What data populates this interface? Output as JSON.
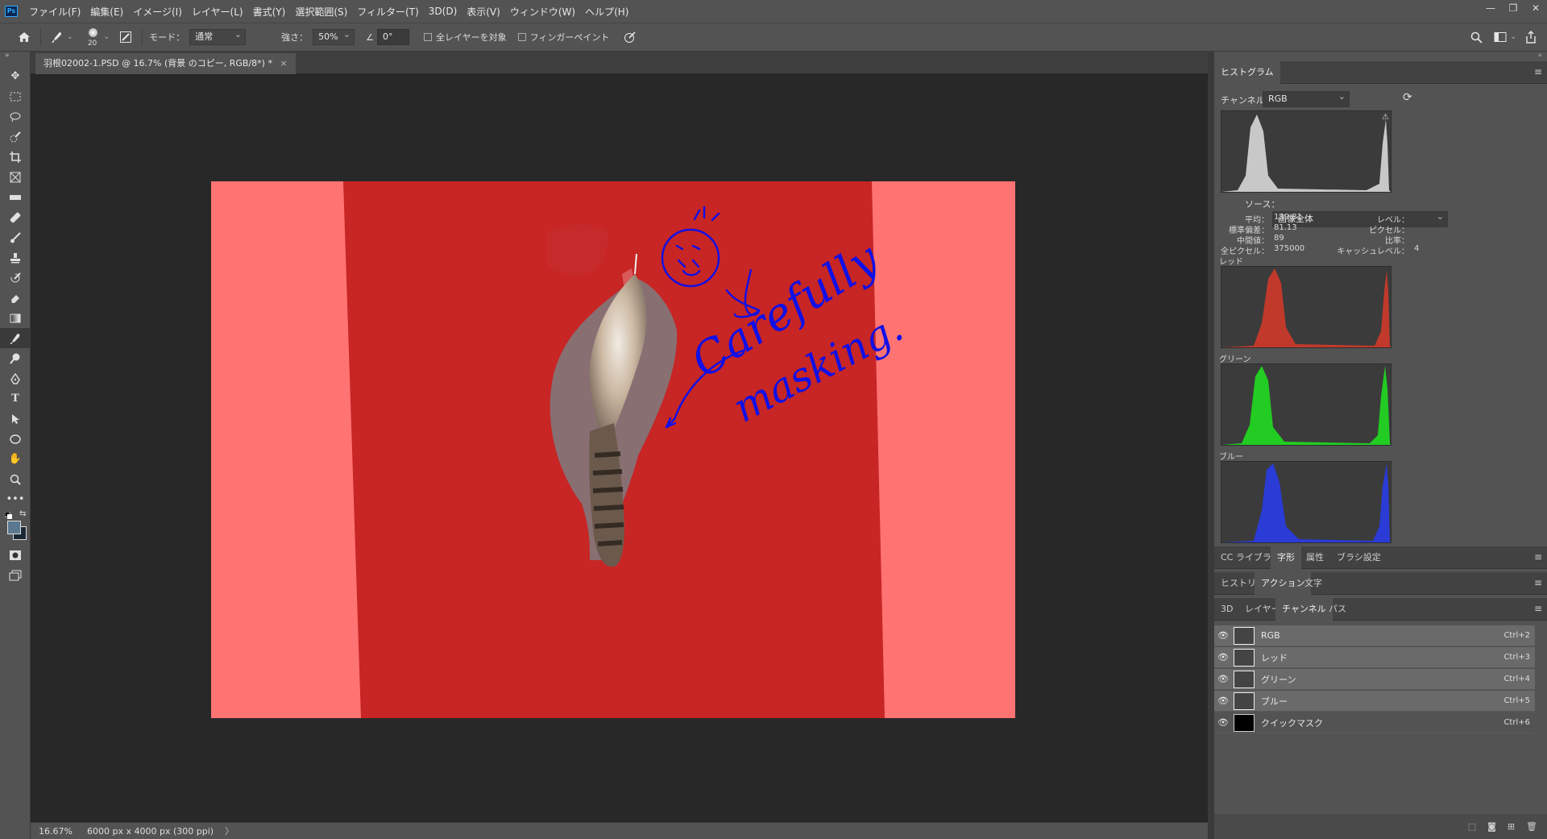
{
  "menubar": {
    "logo": "Ps",
    "items": [
      "ファイル(F)",
      "編集(E)",
      "イメージ(I)",
      "レイヤー(L)",
      "書式(Y)",
      "選択範囲(S)",
      "フィルター(T)",
      "3D(D)",
      "表示(V)",
      "ウィンドウ(W)",
      "ヘルプ(H)"
    ]
  },
  "options": {
    "brush_size": "20",
    "mode_label": "モード：",
    "mode_value": "通常",
    "strength_label": "強さ：",
    "strength_value": "50%",
    "angle_value": "0°",
    "sample_all_layers": "全レイヤーを対象",
    "finger_paint": "フィンガーペイント"
  },
  "document": {
    "tab_title": "羽根02002-1.PSD @ 16.7% (背景 のコピー, RGB/8*) *",
    "close": "×",
    "annotation_line1": "Carefully",
    "annotation_line2": "masking."
  },
  "status": {
    "zoom": "16.67%",
    "doc_size": "6000 px x 4000 px (300 ppi)",
    "arrow": "〉"
  },
  "histogram": {
    "tab": "ヒストグラム",
    "channel_label": "チャンネル：",
    "channel_value": "RGB",
    "source_label": "ソース：",
    "source_value": "画像全体",
    "stats_left": [
      {
        "label": "平均：",
        "value": "139.81"
      },
      {
        "label": "標準偏差：",
        "value": "81.13"
      },
      {
        "label": "中間値：",
        "value": "89"
      },
      {
        "label": "全ピクセル：",
        "value": "375000"
      }
    ],
    "stats_right": [
      {
        "label": "レベル：",
        "value": ""
      },
      {
        "label": "ピクセル：",
        "value": ""
      },
      {
        "label": "比率：",
        "value": ""
      },
      {
        "label": "キャッシュレベル：",
        "value": "4"
      }
    ],
    "red_label": "レッド",
    "green_label": "グリーン",
    "blue_label": "ブルー",
    "colors": {
      "rgb": "#c8c8c8",
      "red": "#c0392b",
      "green": "#22cc22",
      "blue": "#2a3bd6"
    }
  },
  "panel_tabs_1": [
    "CC ライブラリ",
    "字形",
    "属性",
    "ブラシ設定"
  ],
  "panel_tabs_2": [
    "ヒストリー",
    "アクション",
    "文字"
  ],
  "panel_tabs_3": [
    "3D",
    "レイヤー",
    "チャンネル",
    "パス"
  ],
  "channels": [
    {
      "name": "RGB",
      "shortcut": "Ctrl+2"
    },
    {
      "name": "レッド",
      "shortcut": "Ctrl+3"
    },
    {
      "name": "グリーン",
      "shortcut": "Ctrl+4"
    },
    {
      "name": "ブルー",
      "shortcut": "Ctrl+5"
    },
    {
      "name": "クイックマスク",
      "shortcut": "Ctrl+6"
    }
  ]
}
